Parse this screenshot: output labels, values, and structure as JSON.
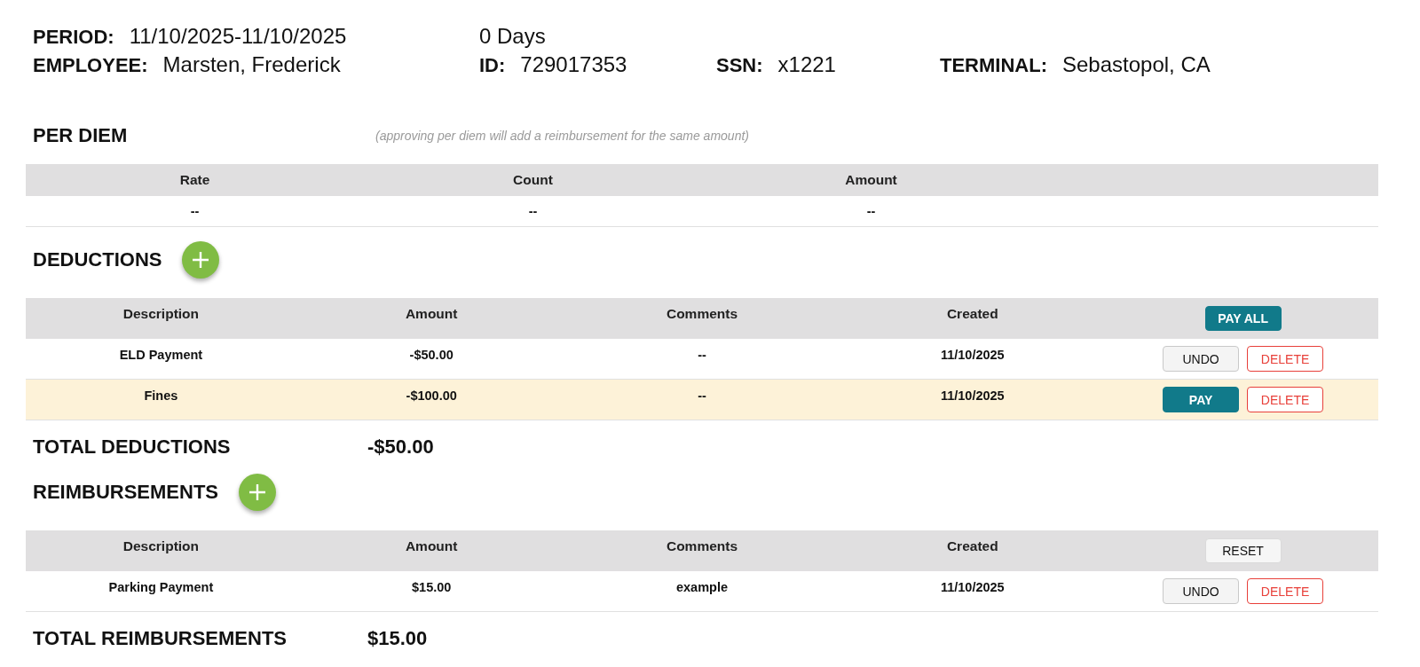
{
  "summary": [
    [
      {
        "label": "PERIOD:",
        "value": "11/10/2025-11/10/2025"
      },
      {
        "value": "0 Days"
      }
    ],
    [
      {
        "label": "EMPLOYEE:",
        "value": "Marsten, Frederick"
      },
      {
        "label": "ID:",
        "value": "729017353"
      },
      {
        "label": "SSN:",
        "value": "x1221"
      },
      {
        "label": "TERMINAL:",
        "value": "Sebastopol, CA"
      }
    ]
  ],
  "sections": [
    {
      "title": "PER DIEM",
      "note": "(approving per diem will add a reimbursement for the same amount)",
      "table": {
        "columns": [
          "Rate",
          "Count",
          "Amount"
        ],
        "rows": [
          {
            "cells": [
              "--",
              "--",
              "--"
            ],
            "highlighted": false
          }
        ]
      }
    },
    {
      "title": "DEDUCTIONS",
      "addable": true,
      "table": {
        "columns": [
          "Description",
          "Amount",
          "Comments",
          "Created"
        ],
        "header_action": {
          "kind": "pay_all",
          "label": "PAY ALL"
        },
        "rows": [
          {
            "cells": [
              "ELD Payment",
              "-$50.00",
              "--",
              "11/10/2025"
            ],
            "highlighted": false,
            "actions": [
              {
                "kind": "undo",
                "label": "UNDO"
              },
              {
                "kind": "delete",
                "label": "DELETE"
              }
            ]
          },
          {
            "cells": [
              "Fines",
              "-$100.00",
              "--",
              "11/10/2025"
            ],
            "highlighted": true,
            "actions": [
              {
                "kind": "pay",
                "label": "PAY"
              },
              {
                "kind": "delete",
                "label": "DELETE"
              }
            ]
          }
        ]
      },
      "total": {
        "label": "TOTAL DEDUCTIONS",
        "value": "-$50.00"
      }
    },
    {
      "title": "REIMBURSEMENTS",
      "addable": true,
      "table": {
        "columns": [
          "Description",
          "Amount",
          "Comments",
          "Created"
        ],
        "header_action": {
          "kind": "reset",
          "label": "RESET"
        },
        "rows": [
          {
            "cells": [
              "Parking Payment",
              "$15.00",
              "example",
              "11/10/2025"
            ],
            "highlighted": false,
            "actions": [
              {
                "kind": "undo",
                "label": "UNDO"
              },
              {
                "kind": "delete",
                "label": "DELETE"
              }
            ]
          }
        ]
      },
      "total": {
        "label": "TOTAL REIMBURSEMENTS",
        "value": "$15.00"
      }
    }
  ]
}
